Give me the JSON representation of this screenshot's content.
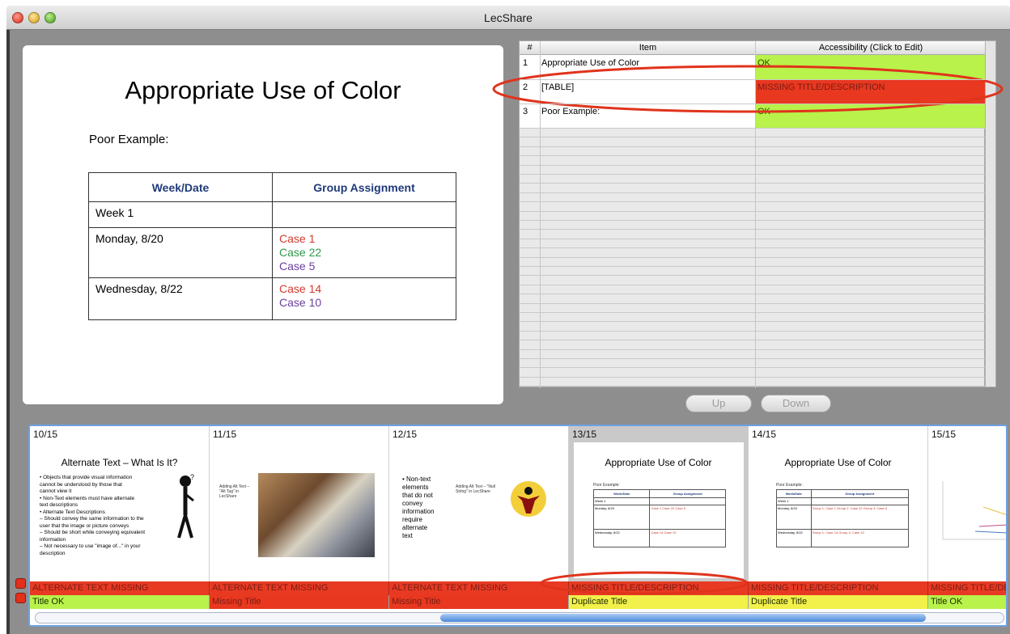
{
  "window": {
    "title": "LecShare"
  },
  "slide": {
    "title": "Appropriate Use of Color",
    "subtitle": "Poor Example:",
    "table": {
      "headers": [
        "Week/Date",
        "Group Assignment"
      ],
      "rows": [
        {
          "date": "Week 1",
          "cases": []
        },
        {
          "date": "Monday, 8/20",
          "cases": [
            {
              "text": "Case 1",
              "color": "#d43a2b"
            },
            {
              "text": "Case 22",
              "color": "#2f9a4a"
            },
            {
              "text": "Case 5",
              "color": "#6b3fa0"
            }
          ]
        },
        {
          "date": "Wednesday, 8/22",
          "cases": [
            {
              "text": "Case 14",
              "color": "#d43a2b"
            },
            {
              "text": "Case 10",
              "color": "#6b3fa0"
            }
          ]
        }
      ]
    }
  },
  "items_table": {
    "headers": {
      "num": "#",
      "item": "Item",
      "accessibility": "Accessibility (Click to Edit)"
    },
    "rows": [
      {
        "num": "1",
        "item": "Appropriate Use of Color",
        "status": "OK",
        "color": "#b8f24a",
        "text_color": "#2a4d00"
      },
      {
        "num": "2",
        "item": "[TABLE]",
        "status": "MISSING TITLE/DESCRIPTION",
        "color": "#e8381f",
        "text_color": "#7a1c14"
      },
      {
        "num": "3",
        "item": "Poor Example:",
        "status": "OK",
        "color": "#b8f24a",
        "text_color": "#2a4d00"
      }
    ]
  },
  "buttons": {
    "up": "Up",
    "down": "Down"
  },
  "thumbnails": [
    {
      "num": "10/15",
      "title": "Alternate Text – What Is It?",
      "bullets": [
        "• Objects that provide visual information",
        "  cannot be understood by those that",
        "  cannot view it",
        "• Non-Text elements must have alternate",
        "  text descriptions",
        "• Alternate Text Descriptions",
        "   – Should convey the same information to the",
        "     user that the image or picture conveys",
        "   – Should be short while conveying equivalent",
        "     information",
        "   – Not necessary to use \"image of...\" in your",
        "     description"
      ],
      "status1": "ALTERNATE TEXT MISSING",
      "status2": "Title OK",
      "status2_color": "#b8f24a"
    },
    {
      "num": "11/15",
      "title": "",
      "caption": "Adding Alt Text – \"Alt Tag\" in LecShare",
      "status1": "ALTERNATE TEXT MISSING",
      "status2": "Missing Title",
      "status2_color": "#e8381f"
    },
    {
      "num": "12/15",
      "title": "",
      "caption": "Adding Alt Text – \"Null String\" in LecShare",
      "bullets": [
        "• Non-text",
        "  elements",
        "  that do not",
        "  convey",
        "  information",
        "  require",
        "  alternate",
        "  text"
      ],
      "status1": "ALTERNATE TEXT MISSING",
      "status2": "Missing Title",
      "status2_color": "#e8381f"
    },
    {
      "num": "13/15",
      "title": "Appropriate Use of Color",
      "status1": "MISSING TITLE/DESCRIPTION",
      "status2": "Duplicate Title",
      "status2_color": "#f2f04a"
    },
    {
      "num": "14/15",
      "title": "Appropriate Use of Color",
      "status1": "MISSING TITLE/DESCRIPTION",
      "status2": "Duplicate Title",
      "status2_color": "#f2f04a"
    },
    {
      "num": "15/15",
      "title": "",
      "status1": "MISSING TITLE/DESCRIPTION",
      "status2": "Title OK",
      "status2_color": "#b8f24a"
    }
  ],
  "mini_table": {
    "headers": [
      "Week/Date",
      "Group Assignment"
    ],
    "rows13": [
      [
        "Week 1",
        ""
      ],
      [
        "Monday, 8/20",
        "Case 1 Case 22 Case 5"
      ],
      [
        "Wednesday, 8/22",
        "Case 14 Case 10"
      ]
    ],
    "rows14": [
      [
        "Week 1",
        ""
      ],
      [
        "Monday, 8/20",
        "Group 1: Case 1 Group 2: Case 22 Group 3: Case 5"
      ],
      [
        "Wednesday, 8/22",
        "Group 1: Case 14 Group 4: Case 10"
      ]
    ]
  }
}
